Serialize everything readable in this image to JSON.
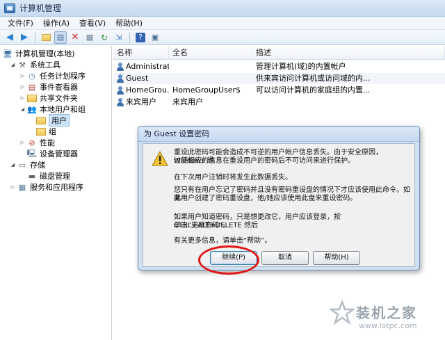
{
  "window": {
    "title": "计算机管理"
  },
  "menu": {
    "items": [
      "文件(F)",
      "操作(A)",
      "查看(V)",
      "帮助(H)"
    ]
  },
  "tree": {
    "items": [
      {
        "label": "计算机管理(本地)"
      },
      {
        "label": "系统工具"
      },
      {
        "label": "任务计划程序"
      },
      {
        "label": "事件查看器"
      },
      {
        "label": "共享文件夹"
      },
      {
        "label": "本地用户和组"
      },
      {
        "label": "用户"
      },
      {
        "label": "组"
      },
      {
        "label": "性能"
      },
      {
        "label": "设备管理器"
      },
      {
        "label": "存储"
      },
      {
        "label": "磁盘管理"
      },
      {
        "label": "服务和应用程序"
      }
    ]
  },
  "list": {
    "columns": [
      "名称",
      "全名",
      "描述"
    ],
    "rows": [
      {
        "name": "Administrat...",
        "fullname": "",
        "desc": "管理计算机(域)的内置帐户"
      },
      {
        "name": "Guest",
        "fullname": "",
        "desc": "供来宾访问计算机或访问域的内..."
      },
      {
        "name": "HomeGrou...",
        "fullname": "HomeGroupUser$",
        "desc": "可以访问计算机的家庭组的内置..."
      },
      {
        "name": "来宾用户",
        "fullname": "来宾用户",
        "desc": ""
      }
    ]
  },
  "dialog": {
    "title": "为 Guest 设置密码",
    "p1a": "重设此密码可能会造成不可逆的用户帐户信息丢失。由于安全原因，Windows 通",
    "p1b": "过使相应的信息在重设用户的密码后不可访问来进行保护。",
    "p2": "在下次用户注销时将发生此数据丢失。",
    "p3a": "您只有在用户忘记了密码并且没有密码重设盘的情况下才应该使用此命令。如果",
    "p3b": "此用户创建了密码重设盘，他/她应该使用此盘来重设密码。",
    "p4a": "如果用户知道密码，只是想更改它，用户应该登录，按 CTRL+ALT+DELETE 然后",
    "p4b": "单击“更改密码”。",
    "p5": "有关更多信息，请单击“帮助”。",
    "buttons": {
      "continue": "继续(P)",
      "cancel": "取消",
      "help": "帮助(H)"
    }
  },
  "watermark": {
    "text": "装机之家",
    "url": "www.lotpc.com"
  }
}
